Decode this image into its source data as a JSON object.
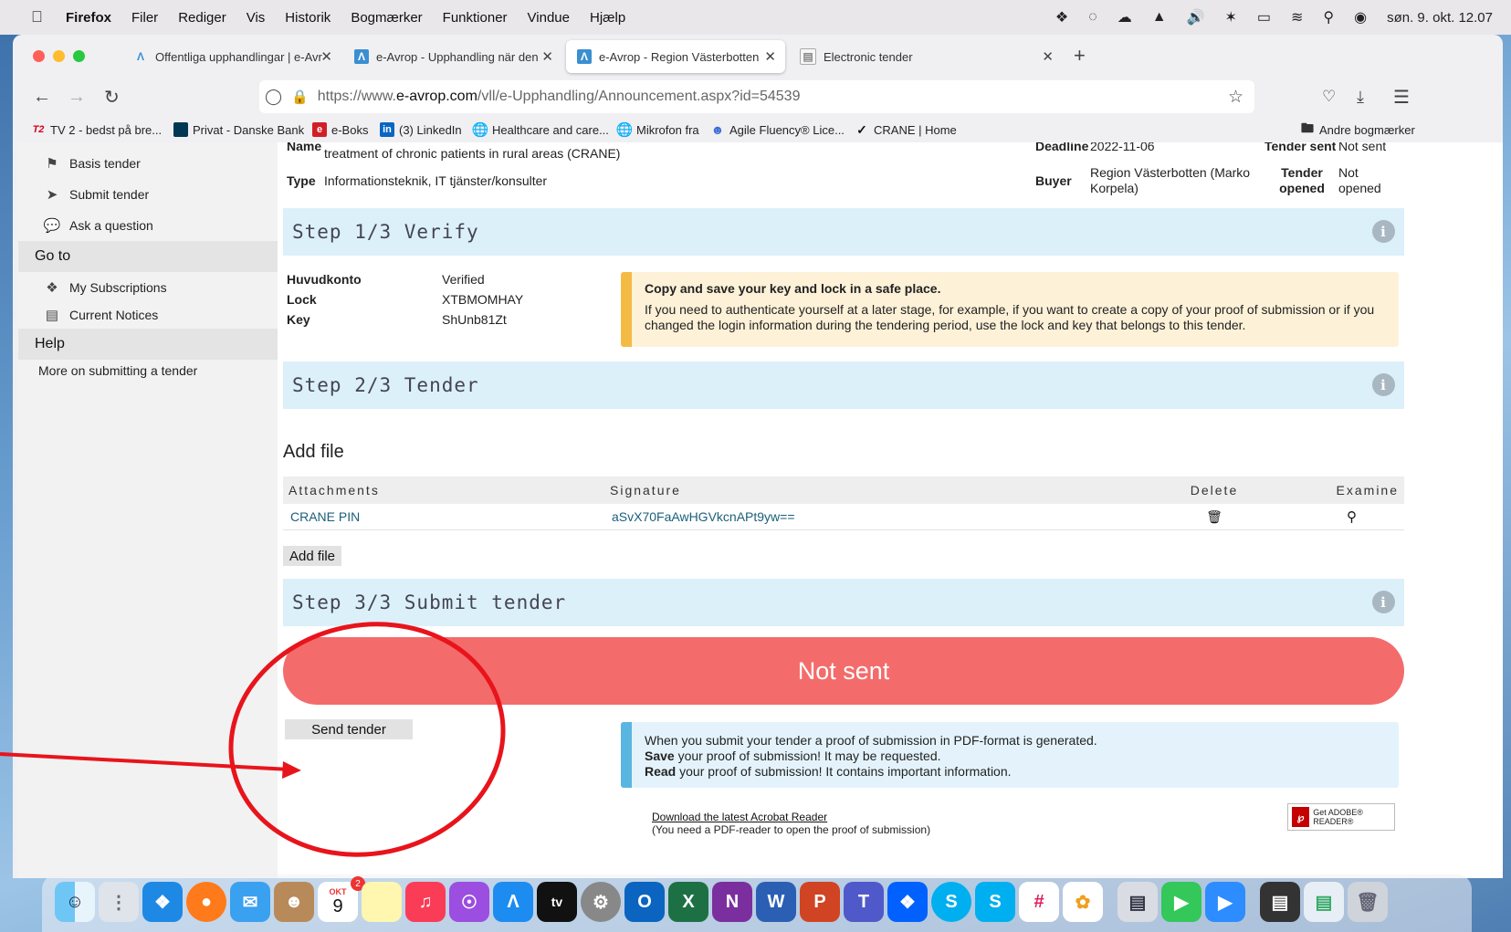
{
  "menubar": {
    "app": "Firefox",
    "items": [
      "Filer",
      "Rediger",
      "Vis",
      "Historik",
      "Bogmærker",
      "Funktioner",
      "Vindue",
      "Hjælp"
    ],
    "datetime": "søn. 9. okt. 12.07"
  },
  "tabs": [
    {
      "label": "Offentliga upphandlingar | e-Avr",
      "favicon": "avrop-icon"
    },
    {
      "label": "e-Avrop - Upphandling när den",
      "favicon": "avrop-icon"
    },
    {
      "label": "e-Avrop - Region Västerbotten",
      "favicon": "avrop-icon",
      "active": true
    },
    {
      "label": "Electronic tender",
      "favicon": "document-icon"
    }
  ],
  "url": {
    "prefix": "https://www.",
    "domain": "e-avrop.com",
    "path": "/vll/e-Upphandling/Announcement.aspx?id=54539"
  },
  "bookmarks": [
    {
      "label": "TV 2 - bedst på bre...",
      "icon": "T2"
    },
    {
      "label": "Privat - Danske Bank",
      "icon": "DB"
    },
    {
      "label": "e-Boks",
      "icon": "e"
    },
    {
      "label": "(3) LinkedIn",
      "icon": "in"
    },
    {
      "label": "Healthcare and care...",
      "icon": "globe"
    },
    {
      "label": "Mikrofon fra",
      "icon": "globe"
    },
    {
      "label": "Agile Fluency® Lice...",
      "icon": "people"
    },
    {
      "label": "CRANE | Home",
      "icon": "crane"
    }
  ],
  "bookmarks_other": "Andre bogmærker",
  "sidebar": {
    "items_top": [
      {
        "label": "Basis tender",
        "icon": "flag-icon"
      },
      {
        "label": "Submit tender",
        "icon": "send-icon"
      },
      {
        "label": "Ask a question",
        "icon": "chat-icon"
      }
    ],
    "goto_heading": "Go to",
    "goto_items": [
      {
        "label": "My Subscriptions",
        "icon": "tags-icon"
      },
      {
        "label": "Current Notices",
        "icon": "list-icon"
      }
    ],
    "help_heading": "Help",
    "help_items": [
      {
        "label": "More on submitting a tender"
      }
    ]
  },
  "tender_meta": {
    "name_label": "Name",
    "name_value": "treatment of chronic patients in rural areas (CRANE)",
    "type_label": "Type",
    "type_value": "Informationsteknik, IT tjänster/konsulter",
    "deadline_label": "Deadline",
    "deadline_value": "2022-11-06",
    "buyer_label": "Buyer",
    "buyer_value": "Region Västerbotten (Marko Korpela)",
    "sent_label": "Tender sent",
    "sent_value": "Not sent",
    "opened_label": "Tender opened",
    "opened_value": "Not opened"
  },
  "step1": {
    "title": "Step 1/3 Verify",
    "fields": [
      {
        "label": "Huvudkonto",
        "value": "Verified"
      },
      {
        "label": "Lock",
        "value": "XTBMOMHAY"
      },
      {
        "label": "Key",
        "value": "ShUnb81Zt"
      }
    ],
    "alert_title": "Copy and save your key and lock in a safe place.",
    "alert_body": "If you need to authenticate yourself at a later stage, for example, if you want to create a copy of your proof of submission or if you changed the login information during the tendering period, use the lock and key that belongs to this tender."
  },
  "step2": {
    "title": "Step 2/3 Tender",
    "add_file_heading": "Add file",
    "columns": [
      "Attachments",
      "Signature",
      "Delete",
      "Examine"
    ],
    "rows": [
      {
        "attachment": "CRANE PIN",
        "signature": "aSvX70FaAwHGVkcnAPt9yw=="
      }
    ],
    "add_file_button": "Add file"
  },
  "step3": {
    "title": "Step 3/3 Submit tender",
    "status": "Not sent",
    "send_button": "Send tender",
    "info_line1": "When you submit your tender a proof of submission in PDF-format is generated.",
    "info_save_bold": "Save",
    "info_save_rest": " your proof of submission! It may be requested.",
    "info_read_bold": "Read",
    "info_read_rest": " your proof of submission! It contains important information.",
    "acrobat_link": "Download the latest Acrobat Reader",
    "acrobat_note": "(You need a PDF-reader to open the proof of submission)",
    "adobe_badge": "Get ADOBE® READER®"
  },
  "dock": {
    "calendar_month": "OKT",
    "calendar_day": "9",
    "calendar_badge": "2"
  },
  "colors": {
    "status_not_sent": "#f46b6b",
    "step_header_bg": "#dcf0fa",
    "warn_bar": "#f4bb44",
    "info_bar": "#5ab6e0",
    "annotation": "#e8141c"
  }
}
